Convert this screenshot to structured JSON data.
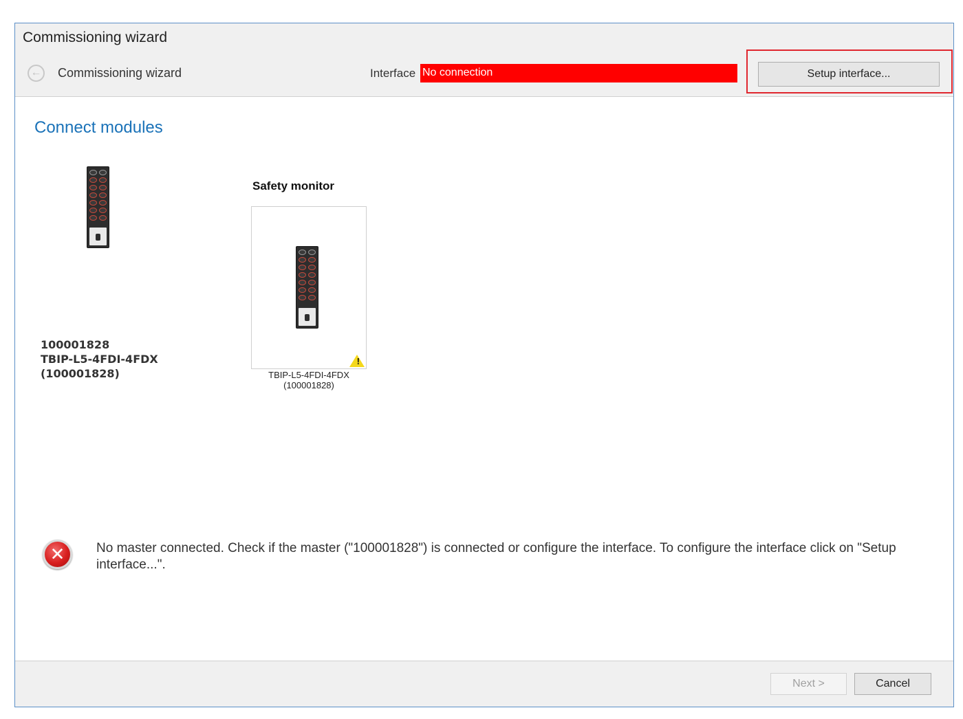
{
  "window": {
    "title": "Commissioning wizard"
  },
  "header": {
    "breadcrumb": "Commissioning wizard",
    "interface_label": "Interface",
    "interface_status": "No connection",
    "setup_button": "Setup interface...",
    "status_color": "#ff0000"
  },
  "main": {
    "section_title": "Connect modules",
    "master_device": {
      "line1": "100001828",
      "line2": "TBIP-L5-4FDI-4FDX",
      "line3": "(100001828)"
    },
    "safety_monitor": {
      "title": "Safety monitor",
      "caption_line1": "TBIP-L5-4FDI-4FDX",
      "caption_line2": "(100001828)",
      "warning_icon": "warning-triangle-icon"
    },
    "error": {
      "icon": "error-icon",
      "message": "No master connected. Check if the master (\"100001828\") is connected or configure the interface. To configure the interface click on \"Setup interface...\"."
    }
  },
  "footer": {
    "next_button": "Next >",
    "cancel_button": "Cancel"
  }
}
